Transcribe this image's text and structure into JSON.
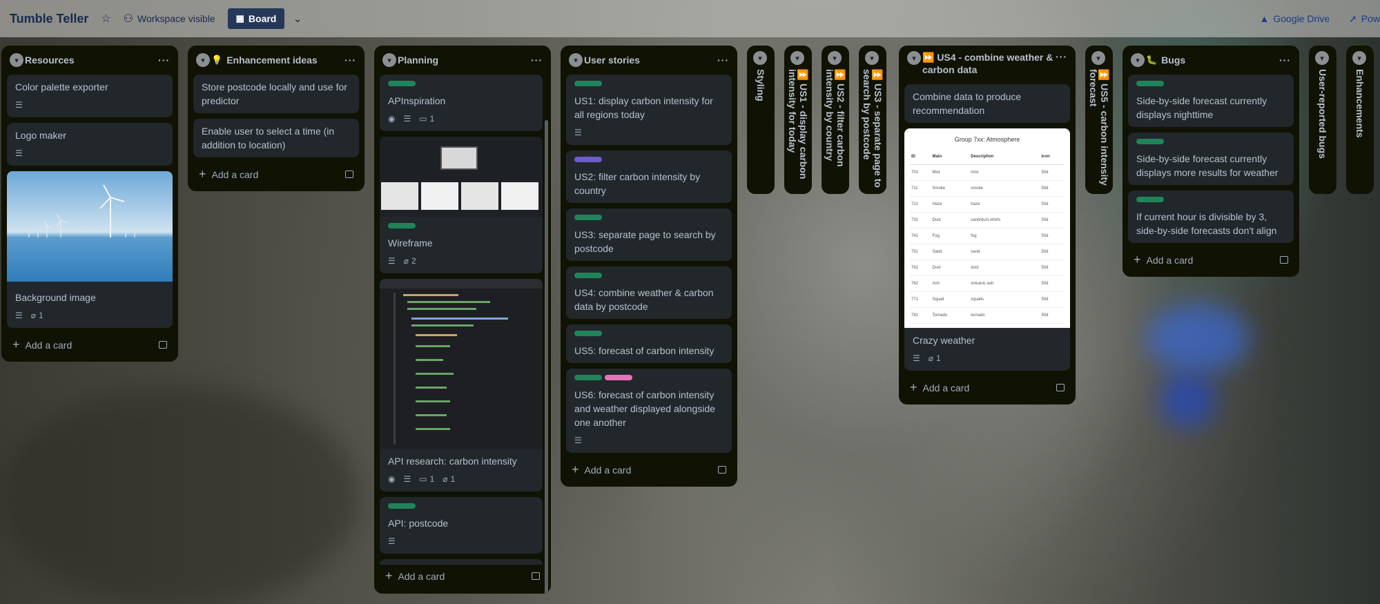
{
  "header": {
    "board_title": "Tumble Teller",
    "visibility": "Workspace visible",
    "view": "Board",
    "right_items": [
      "Google Drive",
      "Pow"
    ]
  },
  "lists": {
    "resources": {
      "title": "Resources",
      "cards": [
        {
          "title": "Color palette exporter"
        },
        {
          "title": "Logo maker"
        },
        {
          "title": "Background image",
          "attachments": "1"
        }
      ],
      "add_card": "Add a card"
    },
    "enhancement": {
      "emoji": "💡",
      "title": "Enhancement ideas",
      "cards": [
        {
          "title": "Store postcode locally and use for predictor"
        },
        {
          "title": "Enable user to select a time (in addition to location)"
        }
      ],
      "add_card": "Add a card"
    },
    "planning": {
      "title": "Planning",
      "cards": [
        {
          "title": "APInspiration",
          "comments": "1"
        },
        {
          "title": "Wireframe",
          "attachments": "2"
        },
        {
          "title": "API research: carbon intensity",
          "comments": "1",
          "attachments": "1"
        },
        {
          "title": "API: postcode"
        }
      ],
      "add_card": "Add a card"
    },
    "user_stories": {
      "title": "User stories",
      "cards": [
        {
          "title": "US1: display carbon intensity for all regions today"
        },
        {
          "title": "US2: filter carbon intensity by country"
        },
        {
          "title": "US3: separate page to search by postcode"
        },
        {
          "title": "US4: combine weather & carbon data by postcode"
        },
        {
          "title": "US5: forecast of carbon intensity"
        },
        {
          "title": "US6: forecast of carbon intensity and weather displayed alongside one another"
        }
      ],
      "add_card": "Add a card"
    },
    "collapsed": [
      {
        "title": "Styling"
      },
      {
        "emoji": "⏩",
        "title": "US1 - display carbon intensity for today"
      },
      {
        "emoji": "⏩",
        "title": "US2 - filter carbon intensity by country"
      },
      {
        "emoji": "⏩",
        "title": "US3 - separate page to search by postcode"
      }
    ],
    "us4": {
      "emoji": "⏩",
      "title": "US4 - combine weather & carbon data",
      "cards": [
        {
          "title": "Combine data to produce recommendation"
        },
        {
          "title": "Crazy weather",
          "attachments": "1"
        }
      ],
      "add_card": "Add a card",
      "cover_table": {
        "caption": "Group 7xx: Atmosphere",
        "headers": [
          "ID",
          "Main",
          "Description",
          "Icon"
        ],
        "rows": [
          [
            "701",
            "Mist",
            "mist",
            "50d"
          ],
          [
            "711",
            "Smoke",
            "smoke",
            "50d"
          ],
          [
            "721",
            "Haze",
            "haze",
            "50d"
          ],
          [
            "731",
            "Dust",
            "sand/dust whirls",
            "50d"
          ],
          [
            "741",
            "Fog",
            "fog",
            "50d"
          ],
          [
            "751",
            "Sand",
            "sand",
            "50d"
          ],
          [
            "761",
            "Dust",
            "dust",
            "50d"
          ],
          [
            "762",
            "Ash",
            "volcanic ash",
            "50d"
          ],
          [
            "771",
            "Squall",
            "squalls",
            "50d"
          ],
          [
            "781",
            "Tornado",
            "tornado",
            "50d"
          ]
        ]
      }
    },
    "us5_collapsed": {
      "emoji": "⏩",
      "title": "US5 - carbon intensity forecast"
    },
    "bugs": {
      "emoji": "🐛",
      "title": "Bugs",
      "cards": [
        {
          "title": "Side-by-side forecast currently displays nighttime"
        },
        {
          "title": "Side-by-side forecast currently displays more results for weather"
        },
        {
          "title": "If current hour is divisible by 3, side-by-side forecasts don't align"
        }
      ],
      "add_card": "Add a card"
    },
    "collapsed_right": [
      {
        "title": "User-reported bugs"
      },
      {
        "title": "Enhancements"
      }
    ]
  },
  "colors": {
    "list_bg": "#101204",
    "card_bg": "#22272b",
    "label_green": "#1f845a",
    "label_purple": "#6e5dc6",
    "label_pink": "#e774bb"
  }
}
